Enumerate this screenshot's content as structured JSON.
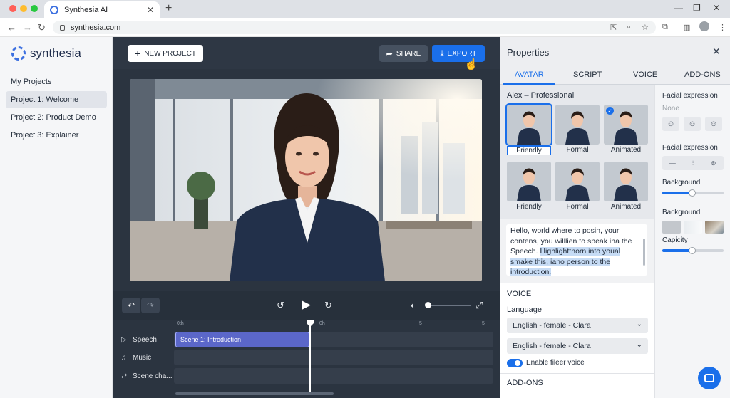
{
  "browser": {
    "tab_title": "Synthesia AI",
    "url": "synthesia.com"
  },
  "sidebar": {
    "logo_text": "synthesia",
    "items": [
      {
        "label": "My Projects"
      },
      {
        "label": "Project 1: Welcome"
      },
      {
        "label": "Project 2: Product Demo"
      },
      {
        "label": "Project 3: Explainer"
      }
    ]
  },
  "toolbar": {
    "new_project": "NEW PROJECT",
    "share": "SHARE",
    "export": "EXPORT"
  },
  "timeline": {
    "ruler": [
      "0th",
      "0h",
      "5",
      "5"
    ],
    "tracks": [
      {
        "label": "Speech"
      },
      {
        "label": "Music"
      },
      {
        "label": "Scene cha..."
      }
    ],
    "clip_label": "Scene 1: Introduction"
  },
  "properties": {
    "title": "Properties",
    "tabs": [
      "AVATAR",
      "SCRIPT",
      "VOICE",
      "ADD-ONS"
    ],
    "avatar_name": "Alex – Professional",
    "styles": [
      {
        "label": "Friendly"
      },
      {
        "label": "Formal"
      },
      {
        "label": "Animated"
      },
      {
        "label": "Friendly"
      },
      {
        "label": "Formal"
      },
      {
        "label": "Animated"
      }
    ],
    "script_plain": "Hello, world where to posin, your contens, you willlien to speak ina the Speech. ",
    "script_highlight": "Highlighttnorn into youal smake this, iano person to the introduction.",
    "voice_title": "VOICE",
    "language_label": "Language",
    "language_1": "English - female - Clara",
    "language_2": "English - female - Clara",
    "toggle_label": "Enable fileer voice",
    "addons_title": "ADD-ONS",
    "right": {
      "facial_label_1": "Facial expression",
      "facial_value": "None",
      "facial_label_2": "Facial expression",
      "background_label_1": "Background",
      "background_label_2": "Background",
      "capacity_label": "Capicity"
    }
  }
}
